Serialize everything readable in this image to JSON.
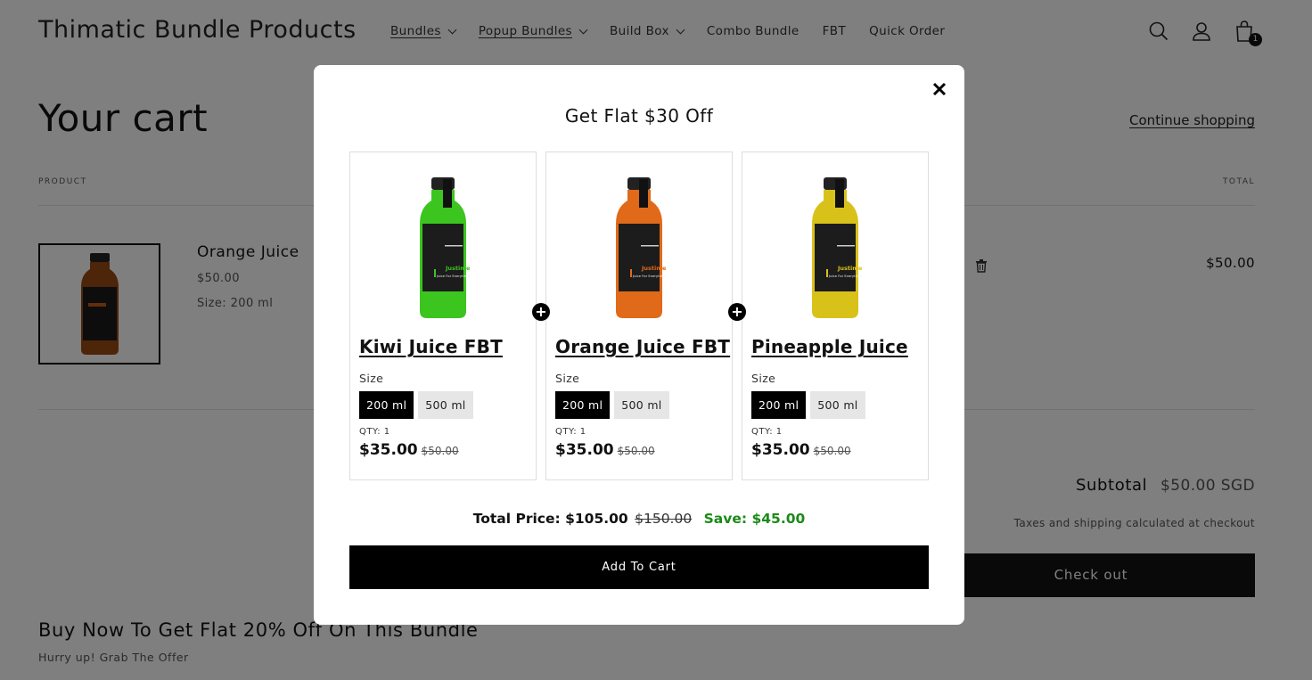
{
  "header": {
    "logo": "Thimatic Bundle Products",
    "nav": [
      {
        "label": "Bundles",
        "dropdown": true,
        "underlined": true
      },
      {
        "label": "Popup Bundles",
        "dropdown": true,
        "underlined": true
      },
      {
        "label": "Build Box",
        "dropdown": true,
        "underlined": false
      },
      {
        "label": "Combo Bundle",
        "dropdown": false,
        "underlined": false
      },
      {
        "label": "FBT",
        "dropdown": false,
        "underlined": false
      },
      {
        "label": "Quick Order",
        "dropdown": false,
        "underlined": false
      }
    ],
    "icons": [
      "search-icon",
      "account-icon",
      "cart-icon"
    ],
    "cart_count": "1"
  },
  "cart": {
    "title": "Your cart",
    "continue_label": "Continue shopping",
    "col_product": "PRODUCT",
    "col_total": "TOTAL",
    "item": {
      "name": "Orange Juice",
      "price": "$50.00",
      "size": "Size: 200 ml",
      "total": "$50.00"
    },
    "subtotal_label": "Subtotal",
    "subtotal_value": "$50.00 SGD",
    "tax_note": "Taxes and shipping calculated at checkout",
    "checkout_label": "Check out"
  },
  "bottom": {
    "title": "Buy Now To Get Flat 20% Off On This Bundle",
    "subtitle": "Hurry up! Grab The Offer"
  },
  "modal": {
    "title": "Get Flat $30 Off",
    "size_label": "Size",
    "products": [
      {
        "name": "Kiwi Juice FBT",
        "sizes": [
          "200 ml",
          "500 ml"
        ],
        "selected": "200 ml",
        "qty": "QTY: 1",
        "price": "$35.00",
        "compare_price": "$50.00",
        "liquid_color": "#3cc41f"
      },
      {
        "name": "Orange Juice FBT",
        "sizes": [
          "200 ml",
          "500 ml"
        ],
        "selected": "200 ml",
        "qty": "QTY: 1",
        "price": "$35.00",
        "compare_price": "$50.00",
        "liquid_color": "#e06a1a"
      },
      {
        "name": "Pineapple Juice",
        "sizes": [
          "200 ml",
          "500 ml"
        ],
        "selected": "200 ml",
        "qty": "QTY: 1",
        "price": "$35.00",
        "compare_price": "$50.00",
        "liquid_color": "#d8c21a"
      }
    ],
    "total_label": "Total Price:",
    "total_price": "$105.00",
    "total_compare": "$150.00",
    "save_text": "Save: $45.00",
    "add_to_cart_label": "Add To Cart",
    "colors": {
      "save": "#1b8a17",
      "button": "#000000"
    }
  }
}
